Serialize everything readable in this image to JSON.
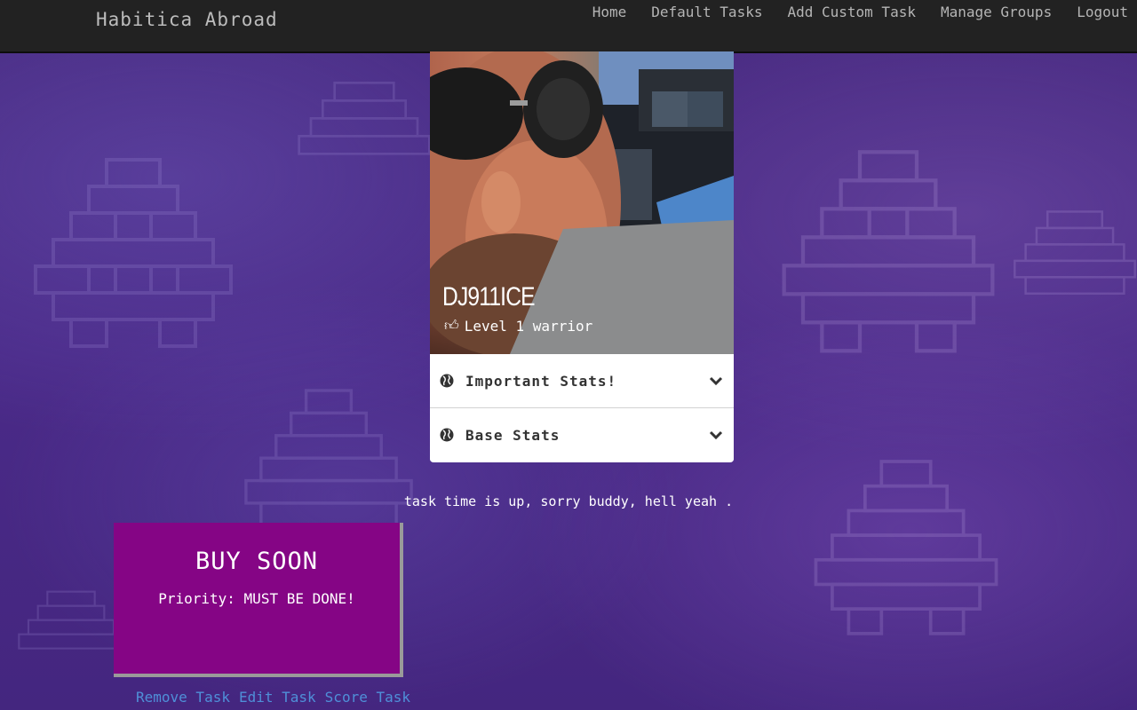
{
  "app": {
    "brand": "Habitica Abroad"
  },
  "nav": {
    "items": [
      {
        "label": "Home"
      },
      {
        "label": "Default Tasks"
      },
      {
        "label": "Add Custom Task"
      },
      {
        "label": "Manage Groups"
      },
      {
        "label": "Logout"
      }
    ]
  },
  "profile": {
    "name": "DJ911ICE",
    "level_text": "Level 1 warrior",
    "level_icon": "thumbs-up-icon",
    "stats": [
      {
        "label": "Important Stats!",
        "icon": "globe-icon",
        "expand_icon": "chevron-down-icon"
      },
      {
        "label": "Base Stats",
        "icon": "globe-icon",
        "expand_icon": "chevron-down-icon"
      }
    ]
  },
  "message": "task time is up, sorry buddy, hell yeah .",
  "task": {
    "title": "BUY SOON",
    "priority": "Priority: MUST BE DONE!",
    "color": "#850585",
    "actions": {
      "remove": "Remove Task",
      "edit": "Edit Task",
      "score": "Score Task"
    }
  },
  "colors": {
    "navbar_bg": "#222222",
    "page_bg": "#4b2a86",
    "link": "#4f8fd8"
  }
}
